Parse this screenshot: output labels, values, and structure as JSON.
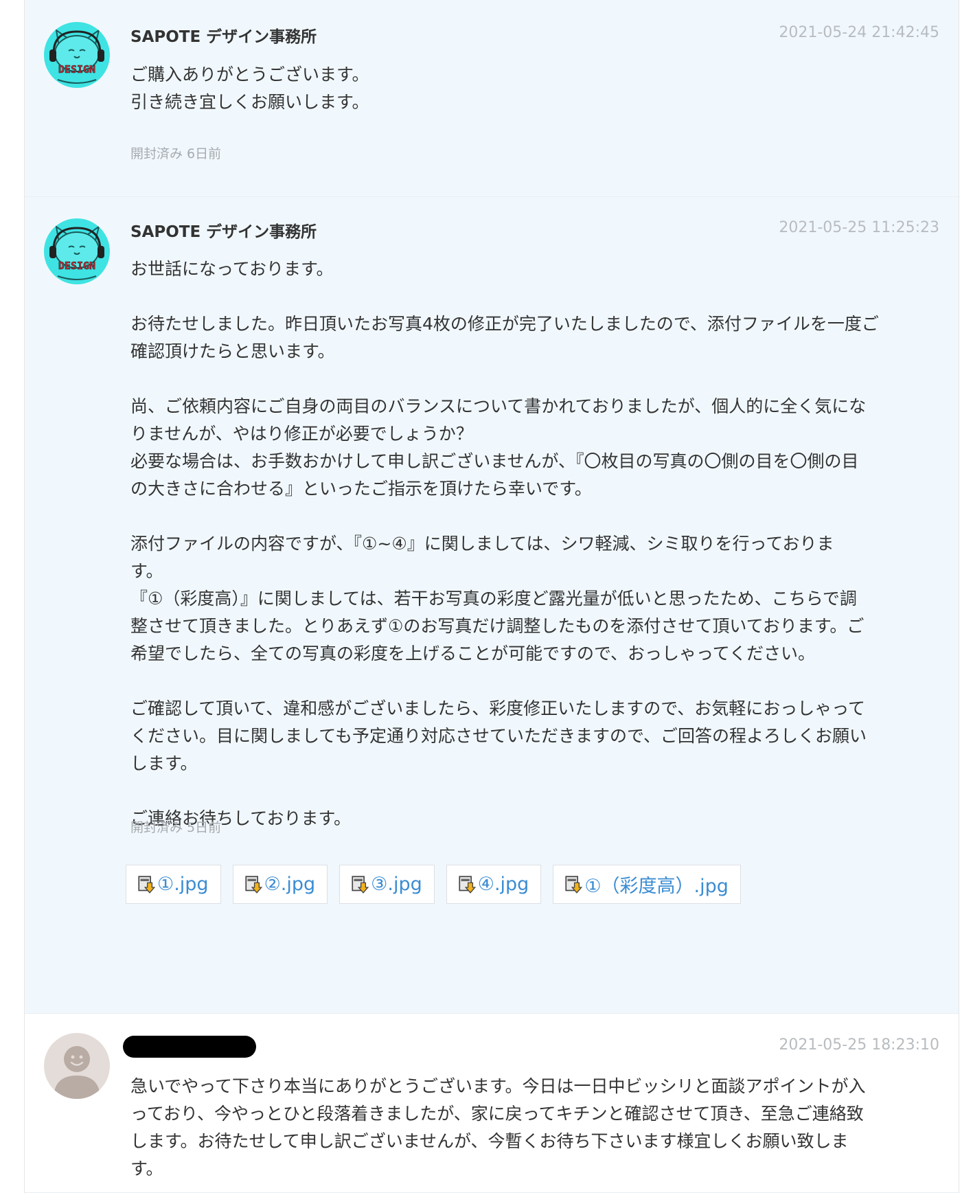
{
  "messages": [
    {
      "sender": "SAPOTE デザイン事務所",
      "avatar_text": "DESIGN",
      "timestamp": "2021-05-24 21:42:45",
      "lines": [
        "ご購入ありがとうございます。",
        "引き続き宜しくお願いします。"
      ],
      "read_status": "開封済み 6日前"
    },
    {
      "sender": "SAPOTE デザイン事務所",
      "avatar_text": "DESIGN",
      "timestamp": "2021-05-25 11:25:23",
      "lines": [
        "お世話になっております。",
        "",
        "お待たせしました。昨日頂いたお写真4枚の修正が完了いたしましたので、添付ファイルを一度ご",
        "確認頂けたらと思います。",
        "",
        "尚、ご依頼内容にご自身の両目のバランスについて書かれておりましたが、個人的に全く気にな",
        "りませんが、やはり修正が必要でしょうか？",
        "必要な場合は、お手数おかけして申し訳ございませんが、『〇枚目の写真の〇側の目を〇側の目",
        "の大きさに合わせる』といったご指示を頂けたら幸いです。",
        "",
        "添付ファイルの内容ですが、『①~④』に関しましては、シワ軽減、シミ取りを行っておりま",
        "す。",
        "『①（彩度高）』に関しましては、若干お写真の彩度ど露光量が低いと思ったため、こちらで調",
        "整させて頂きました。とりあえず①のお写真だけ調整したものを添付させて頂いております。ご",
        "希望でしたら、全ての写真の彩度を上げることが可能ですので、おっしゃってください。",
        "",
        "ご確認して頂いて、違和感がございましたら、彩度修正いたしますので、お気軽におっしゃって",
        "ください。目に関しましても予定通り対応させていただきますので、ご回答の程よろしくお願い",
        "します。",
        "",
        "ご連絡お待ちしております。"
      ],
      "read_status": "開封済み 5日前",
      "attachments": [
        "①.jpg",
        "②.jpg",
        "③.jpg",
        "④.jpg",
        "①（彩度高）.jpg"
      ]
    },
    {
      "sender": "",
      "timestamp": "2021-05-25 18:23:10",
      "lines": [
        "急いでやって下さり本当にありがとうございます。今日は一日中ビッシリと面談アポイントが入",
        "っており、今やっとひと段落着きましたが、家に戻ってキチンと確認させて頂き、至急ご連絡致",
        "します。お待たせして申し訳ございませんが、今暫くお待ち下さいます様宜しくお願い致しま",
        "す。"
      ]
    }
  ],
  "colors": {
    "seller_bg": "#f1f8fd",
    "link": "#3a8cd3",
    "timestamp": "#b8bcc0",
    "avatar_cat_bg": "#3fe3e3"
  },
  "icons": {
    "attachment": "download-file-icon",
    "seller_avatar": "cat-with-headphones-icon",
    "buyer_avatar": "default-user-icon"
  }
}
